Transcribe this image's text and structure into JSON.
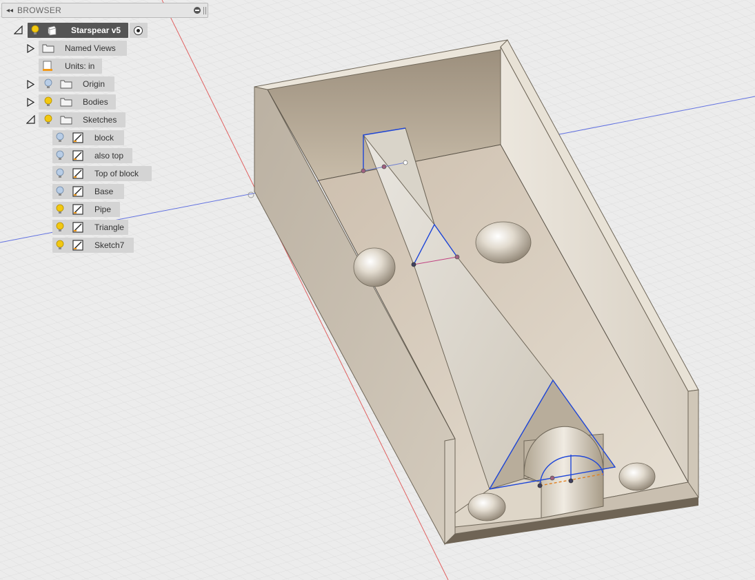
{
  "browser": {
    "title": "BROWSER",
    "root": {
      "label": "Starspear v5"
    },
    "nodes": {
      "named_views": "Named Views",
      "units": "Units: in",
      "origin": "Origin",
      "bodies": "Bodies",
      "sketches": "Sketches"
    },
    "sketches": [
      {
        "label": "block",
        "visible": false
      },
      {
        "label": "also top",
        "visible": false
      },
      {
        "label": "Top of block",
        "visible": false
      },
      {
        "label": "Base",
        "visible": false
      },
      {
        "label": "Pipe",
        "visible": true
      },
      {
        "label": "Triangle",
        "visible": true
      },
      {
        "label": "Sketch7",
        "visible": true
      }
    ]
  },
  "colors": {
    "viewport_bg": "#ececec",
    "grid_line": "#d8d8d8",
    "x_axis": "#e05050",
    "y_axis": "#5060e0",
    "sketch_line": "#1840d8",
    "bulb_on": "#f2c811",
    "bulb_off": "#b8cde6"
  },
  "icons": [
    "collapse-icon",
    "minimize-icon",
    "bulb-icon",
    "component-icon",
    "folder-icon",
    "units-icon",
    "sketch-icon",
    "activate-radio-icon",
    "expand-triangle-icon",
    "collapse-triangle-icon"
  ]
}
